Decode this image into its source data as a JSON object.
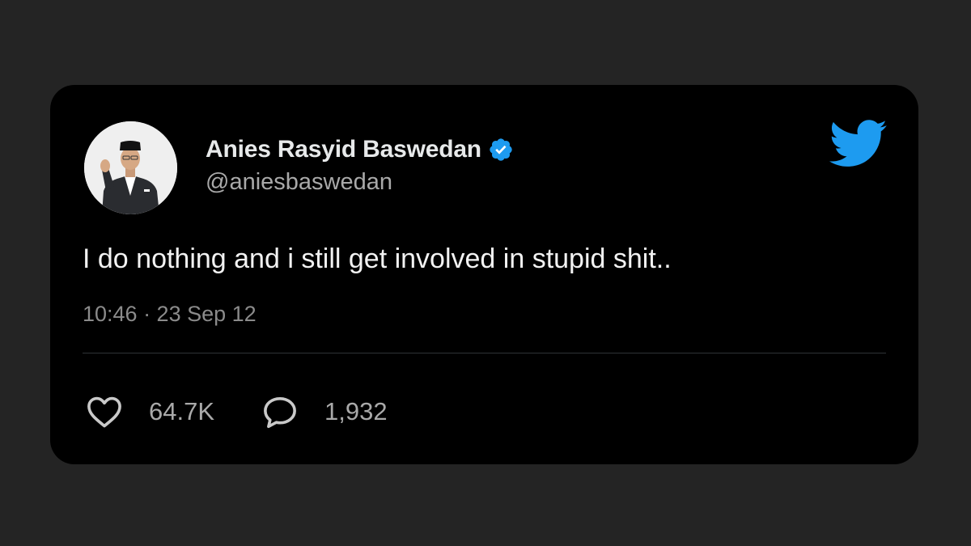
{
  "tweet": {
    "author": {
      "display_name": "Anies Rasyid Baswedan",
      "handle": "@aniesbaswedan",
      "verified": true,
      "avatar": "avatar"
    },
    "text": "I do nothing and i still get involved in stupid shit..",
    "timestamp": "10:46 · 23 Sep 12",
    "stats": {
      "likes": "64.7K",
      "replies": "1,932"
    }
  },
  "icons": {
    "brand": "twitter-bird-icon",
    "verified": "verified-badge-icon",
    "like": "heart-icon",
    "reply": "speech-bubble-icon"
  },
  "colors": {
    "background": "#242424",
    "card": "#000000",
    "brand_blue": "#1d9bf0",
    "primary_text": "#e7e9ea",
    "secondary_text": "#8b8b8b"
  }
}
